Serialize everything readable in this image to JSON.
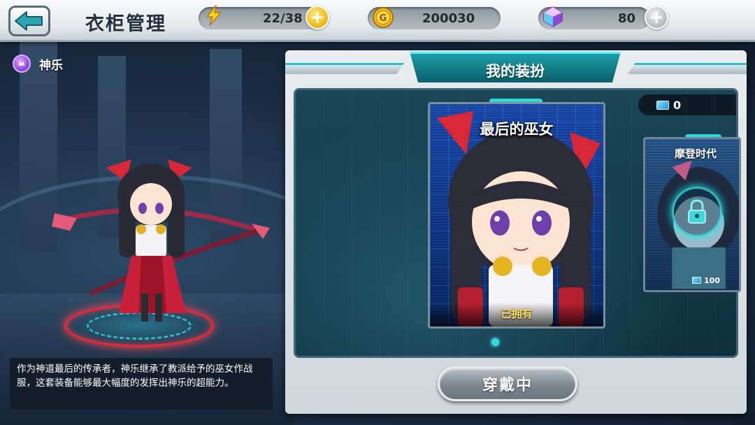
{
  "header": {
    "title": "衣柜管理",
    "stamina": "22/38",
    "gold": "200030",
    "diamonds": "80"
  },
  "character": {
    "name": "神乐",
    "description": "作为神道最后的传承者，神乐继承了教派给予的巫女作战服，这套装备能够最大幅度的发挥出神乐的超能力。"
  },
  "panel": {
    "title": "我的装扮",
    "voucher_count": "0",
    "costumes": [
      {
        "name": "最后的巫女",
        "status": "已拥有"
      },
      {
        "name": "摩登时代",
        "price": "100"
      }
    ],
    "page_count": 1,
    "active_page": 0,
    "action_label": "穿戴中"
  },
  "colors": {
    "accent": "#2fd7dc",
    "gold": "#f3b818",
    "owned_text": "#ffe060"
  }
}
